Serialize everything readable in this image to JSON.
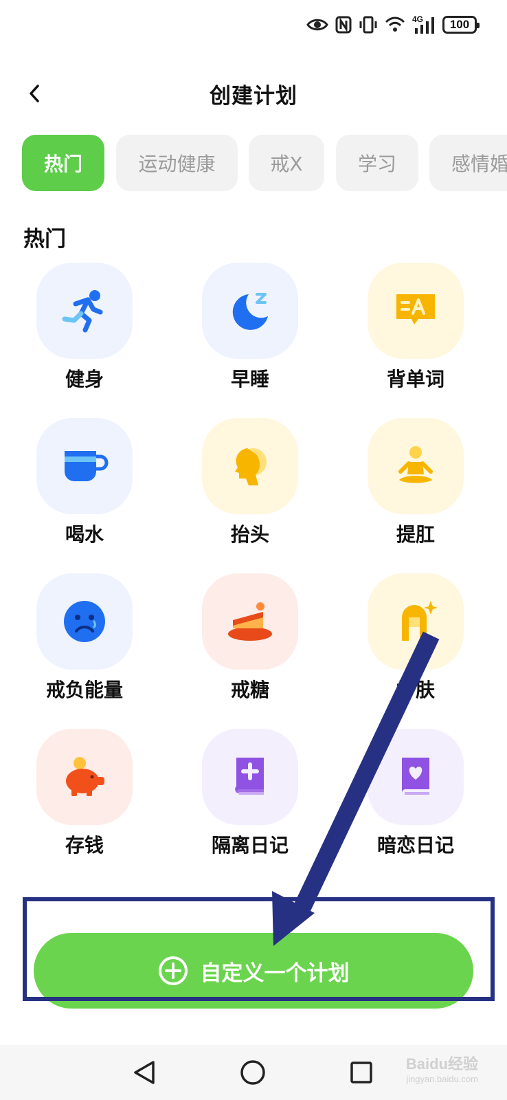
{
  "status_bar": {
    "network": "4G",
    "battery": "100"
  },
  "header": {
    "title": "创建计划"
  },
  "tabs": [
    {
      "label": "热门",
      "active": true
    },
    {
      "label": "运动健康",
      "active": false
    },
    {
      "label": "戒X",
      "active": false
    },
    {
      "label": "学习",
      "active": false
    },
    {
      "label": "感情婚",
      "active": false
    }
  ],
  "section": {
    "title": "热门"
  },
  "plans": [
    {
      "label": "健身",
      "icon": "running-icon"
    },
    {
      "label": "早睡",
      "icon": "moon-sleep-icon"
    },
    {
      "label": "背单词",
      "icon": "vocabulary-card-icon"
    },
    {
      "label": "喝水",
      "icon": "cup-icon"
    },
    {
      "label": "抬头",
      "icon": "head-profile-icon"
    },
    {
      "label": "提肛",
      "icon": "meditation-icon"
    },
    {
      "label": "戒负能量",
      "icon": "sad-face-icon"
    },
    {
      "label": "戒糖",
      "icon": "cake-icon"
    },
    {
      "label": "护肤",
      "icon": "sparkle-face-icon"
    },
    {
      "label": "存钱",
      "icon": "piggy-bank-icon"
    },
    {
      "label": "隔离日记",
      "icon": "medical-book-icon"
    },
    {
      "label": "暗恋日记",
      "icon": "heart-book-icon"
    }
  ],
  "custom_button": {
    "label": "自定义一个计划"
  },
  "watermark": {
    "brand": "Baidu经验",
    "url": "jingyan.baidu.com"
  },
  "colors": {
    "accent_green": "#5dcd4a",
    "tile_blue": "#eef3fd",
    "tile_yellow": "#fff7de",
    "tile_pink": "#fdece8",
    "tile_purple": "#f4effd",
    "annotation": "#263184"
  }
}
